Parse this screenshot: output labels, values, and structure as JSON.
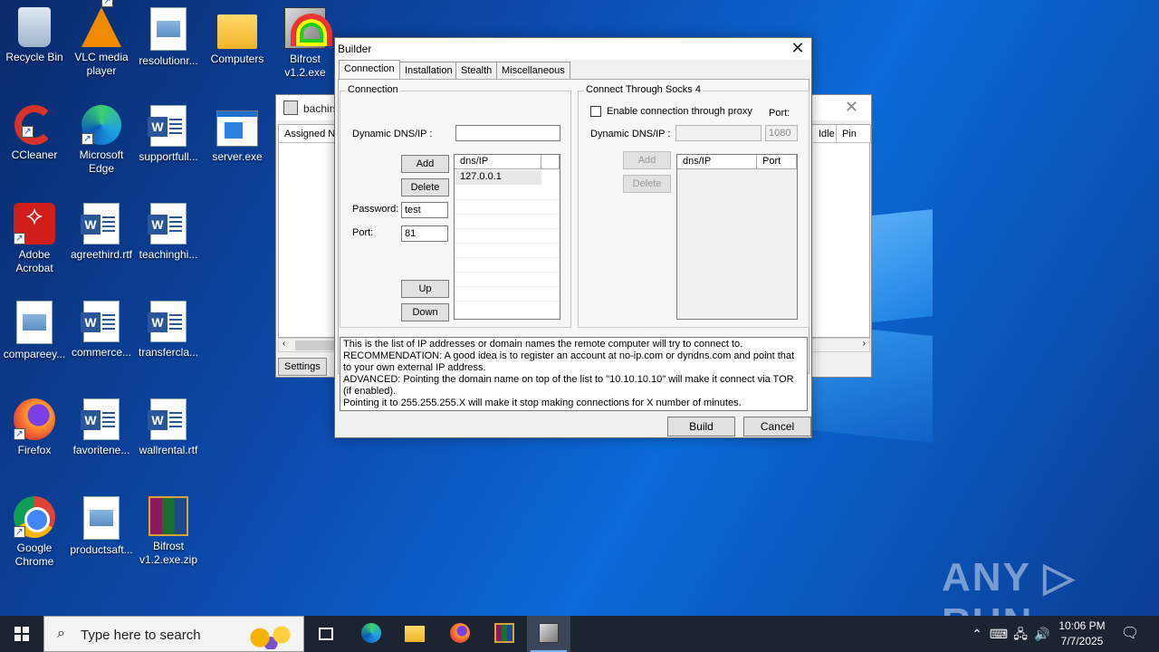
{
  "desktop": {
    "icons": [
      {
        "label": "Recycle Bin"
      },
      {
        "label": "VLC media player"
      },
      {
        "label": "resolutionr..."
      },
      {
        "label": "Computers"
      },
      {
        "label": "Bifrost v1.2.exe"
      },
      {
        "label": "CCleaner"
      },
      {
        "label": "Microsoft Edge"
      },
      {
        "label": "supportfull..."
      },
      {
        "label": "server.exe"
      },
      {
        "label": "Adobe Acrobat"
      },
      {
        "label": "agreethird.rtf"
      },
      {
        "label": "teachinghi..."
      },
      {
        "label": "compareey..."
      },
      {
        "label": "commerce..."
      },
      {
        "label": "transfercla..."
      },
      {
        "label": "Firefox"
      },
      {
        "label": "favoritene..."
      },
      {
        "label": "wallrental.rtf"
      },
      {
        "label": "Google Chrome"
      },
      {
        "label": "productsaft..."
      },
      {
        "label": "Bifrost v1.2.exe.zip"
      }
    ]
  },
  "bg_window": {
    "title": "bachirs",
    "columns": [
      "Assigned N",
      "Idle",
      "Pin"
    ],
    "settings_button": "Settings"
  },
  "dialog": {
    "title": "Builder",
    "tabs": [
      "Connection",
      "Installation",
      "Stealth",
      "Miscellaneous"
    ],
    "connection": {
      "group_title": "Connection",
      "dns_label": "Dynamic DNS/IP :",
      "dns_value": "",
      "add": "Add",
      "delete": "Delete",
      "password_label": "Password:",
      "password_value": "test",
      "port_label": "Port:",
      "port_value": "81",
      "up": "Up",
      "down": "Down",
      "list_header": "dns/IP",
      "list_items": [
        "127.0.0.1"
      ]
    },
    "socks": {
      "group_title": "Connect Through Socks 4",
      "enable_label": "Enable connection through proxy",
      "port_label": "Port:",
      "dns_label": "Dynamic DNS/IP :",
      "port_value": "1080",
      "add": "Add",
      "delete": "Delete",
      "list_headers": [
        "dns/IP",
        "Port"
      ]
    },
    "info_lines": [
      "This is the list of IP addresses or domain names the remote computer will try to connect to.",
      "RECOMMENDATION: A good idea is to register an account at no-ip.com or dyndns.com and point that to your own external IP address.",
      "ADVANCED: Pointing the domain name on top of the list to \"10.10.10.10\" will make it connect via TOR (if enabled).",
      "Pointing it to 255.255.255.X will make it stop making connections for X number of minutes."
    ],
    "build": "Build",
    "cancel": "Cancel"
  },
  "watermark": "ANY ▷ RUN",
  "taskbar": {
    "search_placeholder": "Type here to search",
    "time": "10:06 PM",
    "date": "7/7/2025"
  }
}
